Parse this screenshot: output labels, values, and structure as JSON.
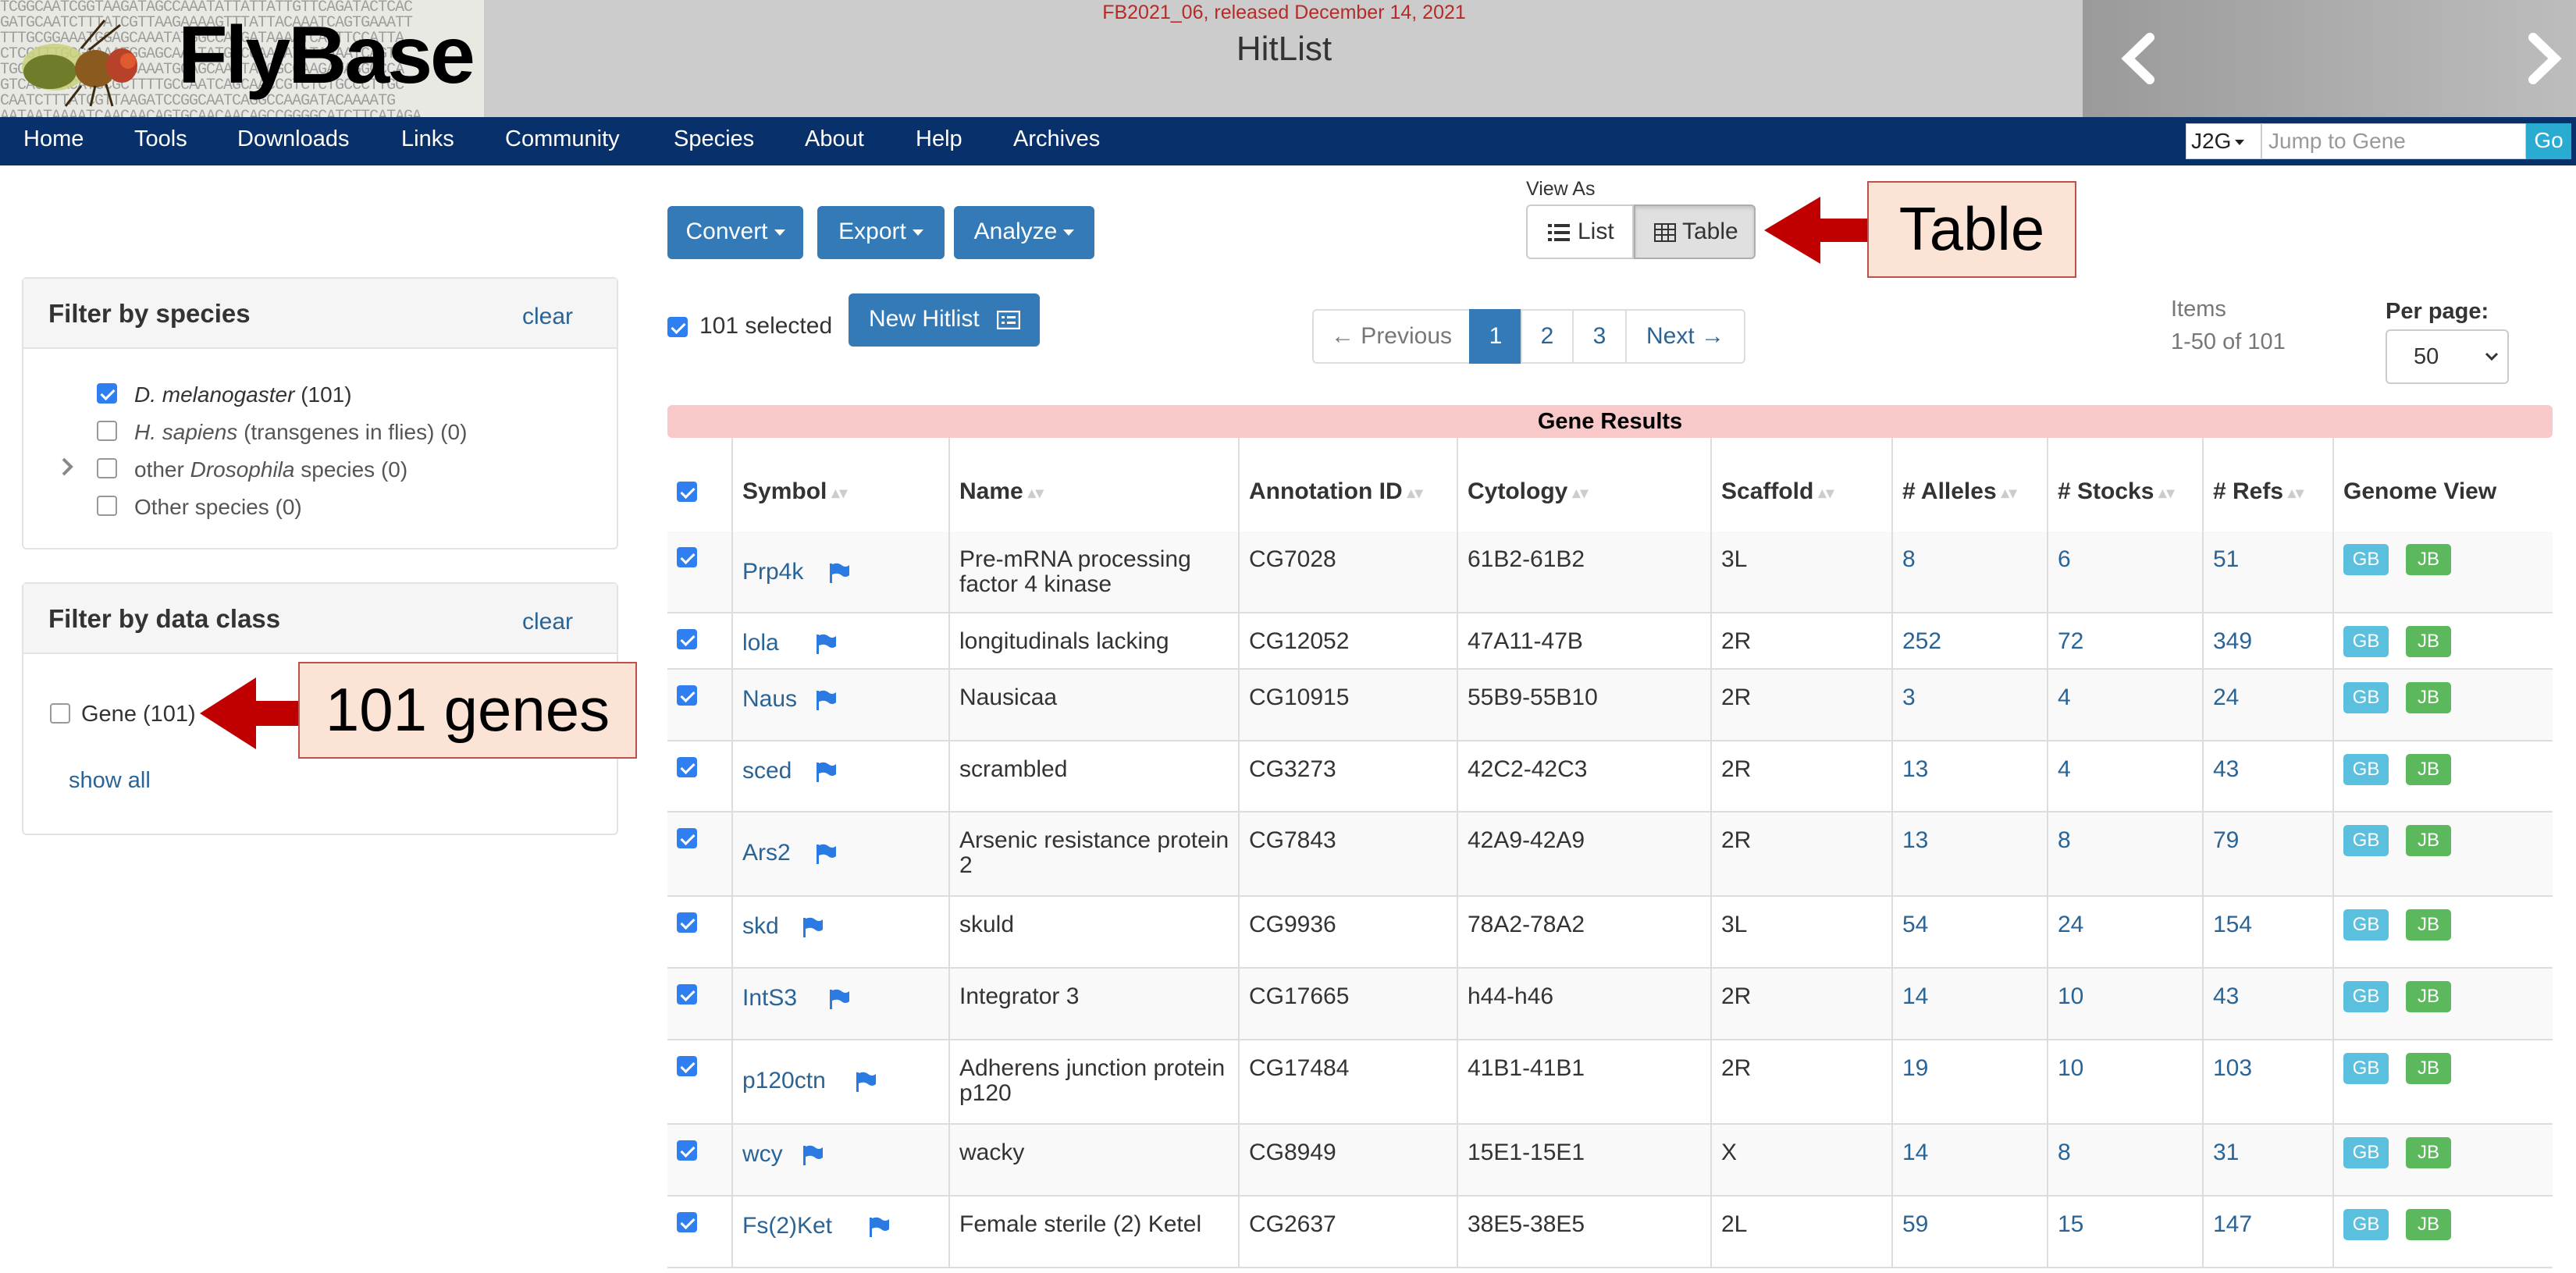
{
  "header": {
    "logo_text": "FlyBase",
    "release": "FB2021_06, released December 14, 2021",
    "page_title": "HitList",
    "dna_lines": [
      "TCGGCAATCGGTAAGATAGCCAAATATTATTATTGTTCAGATACTCAC",
      "GATGCAATCTTTATCGTTAAGAAAAGTTTATTACAAATCAGTGAAATT",
      "TTTGCGGAAATGGAGCAAATATGGCCAAGATAAAATCAGTTCCATTA",
      "CTCGTTTGCGGAAATGGAGCAAATATGGCCAAGATATAAAATCAGTT",
      "TGCCTCTCGTTTGCGGAAATGGAGCAAATATGGCCAAGATAGGCCCA",
      "GTCAGCCACATGCGCTTTTGCCAATCAGCAACCGTCTCTGCCCTTGC",
      "CAATCTTTATCGTTAAGATCCGGCAATCAGGCCAAGATACAAAATG",
      "AATAATAAAATCAACAACAGTGCAACAACAGCCGGGGCATCTTCATAGA"
    ]
  },
  "nav": {
    "items": [
      "Home",
      "Tools",
      "Downloads",
      "Links",
      "Community",
      "Species",
      "About",
      "Help",
      "Archives"
    ],
    "j2g": "J2G",
    "jump_placeholder": "Jump to Gene",
    "go": "Go"
  },
  "filters": {
    "species": {
      "title": "Filter by species",
      "clear": "clear",
      "items": [
        {
          "italic": "D. melanogaster",
          "rest": " (101)"
        },
        {
          "italic": "H. sapiens",
          "rest": " (transgenes in flies) (0)"
        },
        {
          "pre": "other ",
          "italic": "Drosophila",
          "rest": " species (0)"
        },
        {
          "pre": "Other species (0)"
        }
      ]
    },
    "dataclass": {
      "title": "Filter by data class",
      "clear": "clear",
      "gene": "Gene (101)",
      "show_all": "show all"
    }
  },
  "toolbar": {
    "convert": "Convert",
    "export": "Export",
    "analyze": "Analyze",
    "view_as": "View As",
    "list": "List",
    "table": "Table",
    "selected": "101 selected",
    "new_hitlist": "New Hitlist"
  },
  "pagination": {
    "previous": "← Previous",
    "pages": [
      "1",
      "2",
      "3"
    ],
    "next": "Next →",
    "items_label": "Items",
    "items_range": "1-50 of 101",
    "per_page_label": "Per page:",
    "per_page_value": "50"
  },
  "callouts": {
    "table": "Table",
    "genes": "101 genes"
  },
  "table": {
    "title": "Gene Results",
    "headers": [
      "Symbol",
      "Name",
      "Annotation ID",
      "Cytology",
      "Scaffold",
      "# Alleles",
      "# Stocks",
      "# Refs",
      "Genome View"
    ],
    "gb": "GB",
    "jb": "JB",
    "rows": [
      {
        "symbol": "Prp4k",
        "name": [
          "Pre-mRNA processing",
          "factor 4 kinase"
        ],
        "annotation": "CG7028",
        "cytology": "61B2-61B2",
        "scaffold": "3L",
        "alleles": "8",
        "stocks": "6",
        "refs": "51"
      },
      {
        "symbol": "lola",
        "name": [
          "longitudinals lacking"
        ],
        "annotation": "CG12052",
        "cytology": "47A11-47B",
        "scaffold": "2R",
        "alleles": "252",
        "stocks": "72",
        "refs": "349"
      },
      {
        "symbol": "Naus",
        "name": [
          "Nausicaa"
        ],
        "annotation": "CG10915",
        "cytology": "55B9-55B10",
        "scaffold": "2R",
        "alleles": "3",
        "stocks": "4",
        "refs": "24"
      },
      {
        "symbol": "sced",
        "name": [
          "scrambled"
        ],
        "annotation": "CG3273",
        "cytology": "42C2-42C3",
        "scaffold": "2R",
        "alleles": "13",
        "stocks": "4",
        "refs": "43"
      },
      {
        "symbol": "Ars2",
        "name": [
          "Arsenic resistance protein",
          "2"
        ],
        "annotation": "CG7843",
        "cytology": "42A9-42A9",
        "scaffold": "2R",
        "alleles": "13",
        "stocks": "8",
        "refs": "79"
      },
      {
        "symbol": "skd",
        "name": [
          "skuld"
        ],
        "annotation": "CG9936",
        "cytology": "78A2-78A2",
        "scaffold": "3L",
        "alleles": "54",
        "stocks": "24",
        "refs": "154"
      },
      {
        "symbol": "IntS3",
        "name": [
          "Integrator 3"
        ],
        "annotation": "CG17665",
        "cytology": "h44-h46",
        "scaffold": "2R",
        "alleles": "14",
        "stocks": "10",
        "refs": "43"
      },
      {
        "symbol": "p120ctn",
        "name": [
          "Adherens junction protein",
          "p120"
        ],
        "annotation": "CG17484",
        "cytology": "41B1-41B1",
        "scaffold": "2R",
        "alleles": "19",
        "stocks": "10",
        "refs": "103"
      },
      {
        "symbol": "wcy",
        "name": [
          "wacky"
        ],
        "annotation": "CG8949",
        "cytology": "15E1-15E1",
        "scaffold": "X",
        "alleles": "14",
        "stocks": "8",
        "refs": "31"
      },
      {
        "symbol": "Fs(2)Ket",
        "name": [
          "Female sterile (2) Ketel"
        ],
        "annotation": "CG2637",
        "cytology": "38E5-38E5",
        "scaffold": "2L",
        "alleles": "59",
        "stocks": "15",
        "refs": "147"
      }
    ]
  }
}
